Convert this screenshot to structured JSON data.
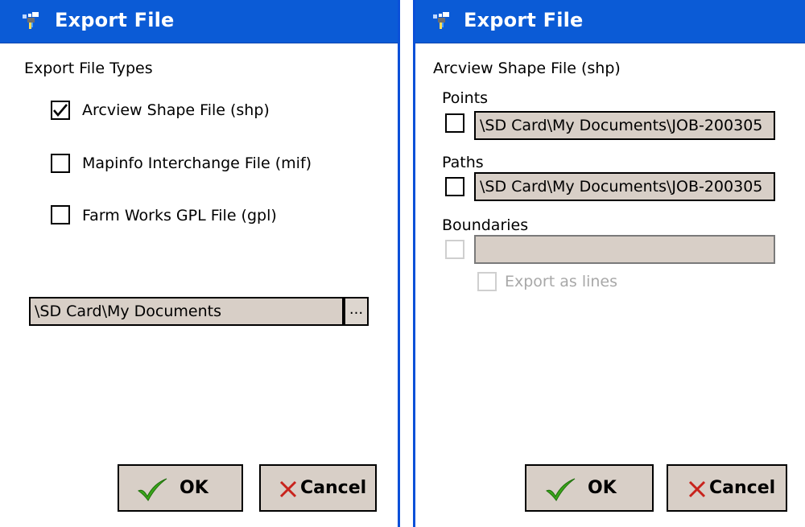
{
  "left": {
    "title": "Export File",
    "caption": "Export File Types",
    "options": [
      {
        "label": "Arcview Shape File (shp)",
        "checked": true
      },
      {
        "label": "Mapinfo Interchange File (mif)",
        "checked": false
      },
      {
        "label": "Farm Works GPL File (gpl)",
        "checked": false
      }
    ],
    "path": "\\SD Card\\My Documents",
    "browse_label": "...",
    "ok_label": "OK",
    "cancel_label": "Cancel"
  },
  "right": {
    "title": "Export File",
    "caption": "Arcview Shape File (shp)",
    "points": {
      "label": "Points",
      "path": "\\SD Card\\My Documents\\JOB-200305",
      "checked": false
    },
    "paths": {
      "label": "Paths",
      "path": "\\SD Card\\My Documents\\JOB-200305",
      "checked": false
    },
    "boundaries": {
      "label": "Boundaries",
      "path": "",
      "checked": false,
      "enabled": false
    },
    "export_lines": {
      "label": "Export as lines",
      "checked": false,
      "enabled": false
    },
    "ok_label": "OK",
    "cancel_label": "Cancel"
  },
  "colors": {
    "titlebar": "#0b5bd6",
    "field_bg": "#d8cfc7",
    "ok_check": "#3aa51a",
    "cancel_x": "#c8231c"
  }
}
